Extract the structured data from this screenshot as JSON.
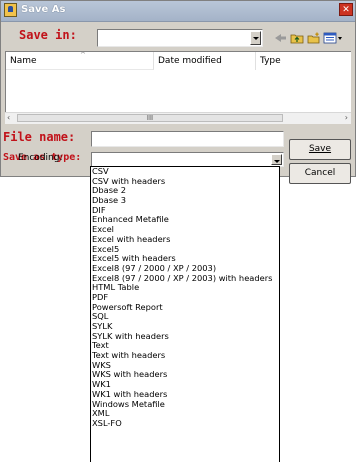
{
  "window": {
    "title": "Save As"
  },
  "save_in": {
    "label": "Save in:",
    "value": ""
  },
  "file_list": {
    "columns": [
      "Name",
      "Date modified",
      "Type"
    ],
    "scroll_grip": "III"
  },
  "file_name": {
    "label": "File name:",
    "value": ""
  },
  "save_as_type": {
    "label": "Save as type:",
    "value": "",
    "options": [
      "CSV",
      "CSV with headers",
      "Dbase 2",
      "Dbase 3",
      "DIF",
      "Enhanced Metafile",
      "Excel",
      "Excel with headers",
      "Excel5",
      "Excel5 with headers",
      "Excel8 (97 / 2000 / XP / 2003)",
      "Excel8 (97 / 2000 / XP / 2003) with headers",
      "HTML Table",
      "PDF",
      "Powersoft Report",
      "SQL",
      "SYLK",
      "SYLK with headers",
      "Text",
      "Text with headers",
      "WKS",
      "WKS with headers",
      "WK1",
      "WK1 with headers",
      "Windows Metafile",
      "XML",
      "XSL-FO"
    ]
  },
  "encoding": {
    "label": "Encoding:"
  },
  "buttons": {
    "save": "Save",
    "cancel": "Cancel"
  },
  "icons": {
    "app": "app-icon",
    "close": "close-icon",
    "back": "back-arrow-icon",
    "up": "up-folder-icon",
    "new_folder": "new-folder-icon",
    "views": "views-menu-icon"
  }
}
